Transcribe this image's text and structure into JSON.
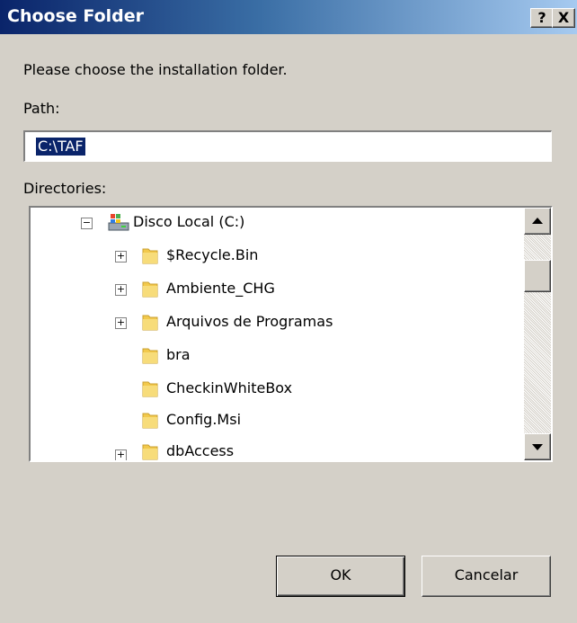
{
  "window": {
    "title": "Choose Folder",
    "help_button": "?",
    "close_button": "X"
  },
  "prompt": "Please choose the installation folder.",
  "path": {
    "label": "Path:",
    "value": "C:\\TAF"
  },
  "directories": {
    "label": "Directories:",
    "root": {
      "label": "Disco Local (C:)",
      "expander": "−",
      "icon": "drive-icon"
    },
    "items": [
      {
        "label": "$Recycle.Bin",
        "expander": "+",
        "icon": "folder-icon"
      },
      {
        "label": "Ambiente_CHG",
        "expander": "+",
        "icon": "folder-icon"
      },
      {
        "label": "Arquivos de Programas",
        "expander": "+",
        "icon": "folder-icon"
      },
      {
        "label": "bra",
        "expander": "",
        "icon": "folder-icon"
      },
      {
        "label": "CheckinWhiteBox",
        "expander": "",
        "icon": "folder-icon"
      },
      {
        "label": "Config.Msi",
        "expander": "",
        "icon": "folder-icon"
      },
      {
        "label": "dbAccess",
        "expander": "+",
        "icon": "folder-icon"
      }
    ]
  },
  "buttons": {
    "ok": "OK",
    "cancel": "Cancelar"
  },
  "colors": {
    "titlebar_start": "#0a246a",
    "titlebar_end": "#a6caf0",
    "dialog_bg": "#d4d0c8",
    "selection": "#0a246a",
    "folder": "#f2c94c"
  }
}
